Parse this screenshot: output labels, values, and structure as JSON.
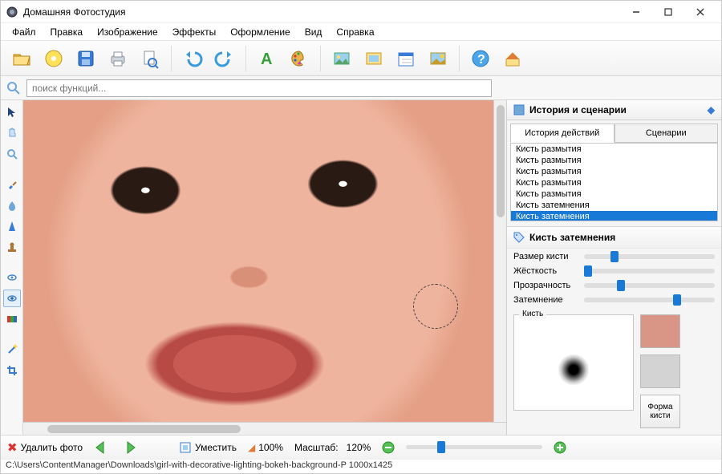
{
  "app": {
    "title": "Домашняя Фотостудия"
  },
  "menu": [
    "Файл",
    "Правка",
    "Изображение",
    "Эффекты",
    "Оформление",
    "Вид",
    "Справка"
  ],
  "toolbar_icons": [
    "open",
    "cd",
    "save",
    "print",
    "preview",
    "undo",
    "redo",
    "text",
    "palette",
    "image1",
    "image2",
    "calendar",
    "image3",
    "help",
    "home"
  ],
  "search": {
    "placeholder": "поиск функций..."
  },
  "right": {
    "header": "История и сценарии",
    "tabs": {
      "a": "История действий",
      "b": "Сценарии"
    },
    "history": [
      "Кисть размытия",
      "Кисть размытия",
      "Кисть размытия",
      "Кисть размытия",
      "Кисть размытия",
      "Кисть затемнения",
      "Кисть затемнения"
    ],
    "history_selected": 6,
    "panel_title": "Кисть затемнения",
    "sliders": [
      {
        "label": "Размер кисти",
        "value": 20
      },
      {
        "label": "Жёсткость",
        "value": 0
      },
      {
        "label": "Прозрачность",
        "value": 25
      },
      {
        "label": "Затемнение",
        "value": 68
      }
    ],
    "brush_box": "Кисть",
    "shape_btn": "Форма кисти",
    "swatch1": "#d99586",
    "swatch2": "#d3d3d3"
  },
  "bottom": {
    "delete": "Удалить фото",
    "fit": "Уместить",
    "percent": "100%",
    "zoom_label": "Масштаб:",
    "zoom_value": "120%"
  },
  "status": "C:\\Users\\ContentManager\\Downloads\\girl-with-decorative-lighting-bokeh-background-P  1000x1425"
}
